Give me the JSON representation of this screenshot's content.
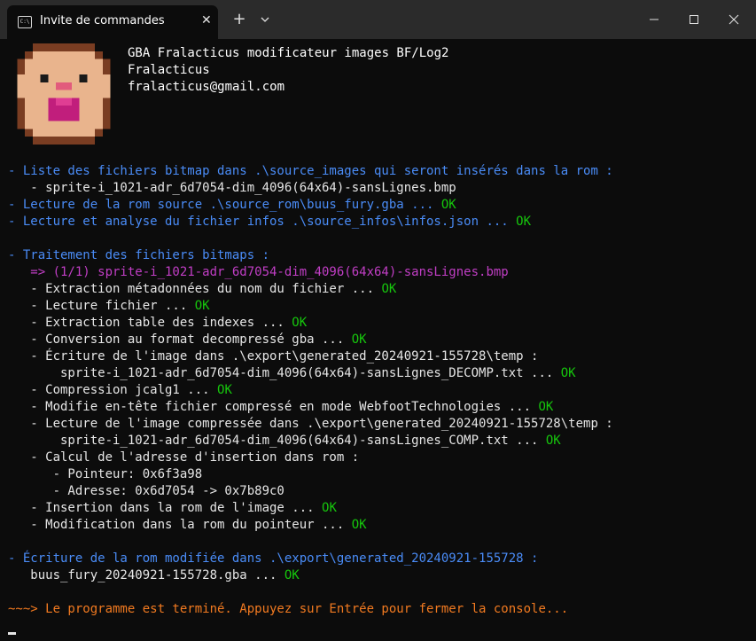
{
  "window": {
    "tab_title": "Invite de commandes",
    "tab_icon": "terminal-icon",
    "new_tab_glyph": "+",
    "dropdown_glyph": "⌄",
    "close_glyph": "✕"
  },
  "header": {
    "title": "GBA Fralacticus modificateur images BF/Log2",
    "author": "Fralacticus",
    "email": "fralacticus@gmail.com"
  },
  "lines": {
    "l1": "- Liste des fichiers bitmap dans .\\source_images qui seront insérés dans la rom :",
    "l2": "   - sprite-i_1021-adr_6d7054-dim_4096(64x64)-sansLignes.bmp",
    "l3": "- Lecture de la rom source .\\source_rom\\buus_fury.gba ... ",
    "l3ok": "OK",
    "l4": "- Lecture et analyse du fichier infos .\\source_infos\\infos.json ... ",
    "l4ok": "OK",
    "l5": "- Traitement des fichiers bitmaps :",
    "l6": "   => (1/1) sprite-i_1021-adr_6d7054-dim_4096(64x64)-sansLignes.bmp",
    "l7": "   - Extraction métadonnées du nom du fichier ... ",
    "l7ok": "OK",
    "l8": "   - Lecture fichier ... ",
    "l8ok": "OK",
    "l9": "   - Extraction table des indexes ... ",
    "l9ok": "OK",
    "l10": "   - Conversion au format decompressé gba ... ",
    "l10ok": "OK",
    "l11": "   - Écriture de l'image dans .\\export\\generated_20240921-155728\\temp :",
    "l12": "       sprite-i_1021-adr_6d7054-dim_4096(64x64)-sansLignes_DECOMP.txt ... ",
    "l12ok": "OK",
    "l13": "   - Compression jcalg1 ... ",
    "l13ok": "OK",
    "l14": "   - Modifie en-tête fichier compressé en mode WebfootTechnologies ... ",
    "l14ok": "OK",
    "l15": "   - Lecture de l'image compressée dans .\\export\\generated_20240921-155728\\temp :",
    "l16": "       sprite-i_1021-adr_6d7054-dim_4096(64x64)-sansLignes_COMP.txt ... ",
    "l16ok": "OK",
    "l17": "   - Calcul de l'adresse d'insertion dans rom :",
    "l18": "      - Pointeur: 0x6f3a98",
    "l19": "      - Adresse: 0x6d7054 -> 0x7b89c0",
    "l20": "   - Insertion dans la rom de l'image ... ",
    "l20ok": "OK",
    "l21": "   - Modification dans la rom du pointeur ... ",
    "l21ok": "OK",
    "l22": "- Écriture de la rom modifiée dans .\\export\\generated_20240921-155728 :",
    "l23": "   buus_fury_20240921-155728.gba ... ",
    "l23ok": "OK",
    "l24": "~~~> Le programme est terminé. Appuyez sur Entrée pour fermer la console..."
  },
  "colors": {
    "accent_blue": "#4a8cf7",
    "ok_green": "#16c60c",
    "magenta": "#c13ec5",
    "orange": "#f27a20",
    "background": "#0c0c0c"
  },
  "avatar_icon": "pixel-monkey-avatar"
}
